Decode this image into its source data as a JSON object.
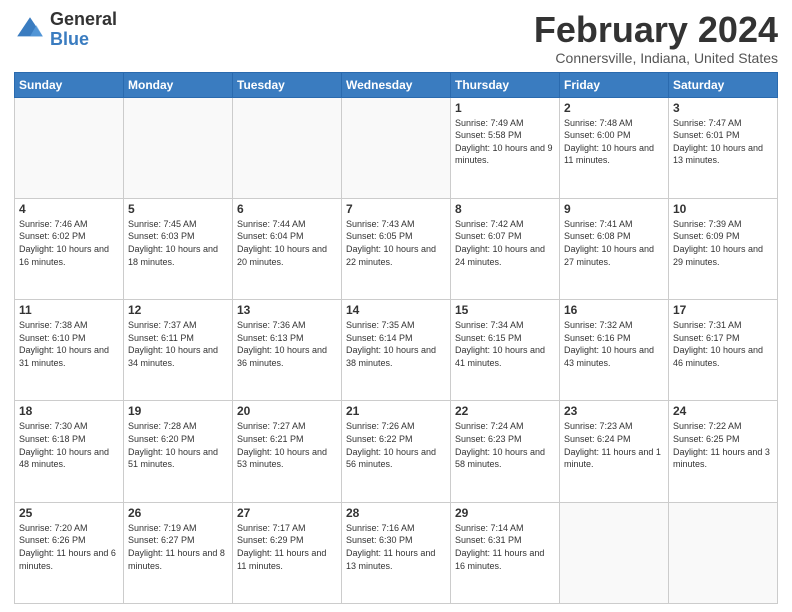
{
  "header": {
    "title": "February 2024",
    "subtitle": "Connersville, Indiana, United States",
    "logo_general": "General",
    "logo_blue": "Blue"
  },
  "days_of_week": [
    "Sunday",
    "Monday",
    "Tuesday",
    "Wednesday",
    "Thursday",
    "Friday",
    "Saturday"
  ],
  "weeks": [
    [
      {
        "day": "",
        "info": ""
      },
      {
        "day": "",
        "info": ""
      },
      {
        "day": "",
        "info": ""
      },
      {
        "day": "",
        "info": ""
      },
      {
        "day": "1",
        "info": "Sunrise: 7:49 AM\nSunset: 5:58 PM\nDaylight: 10 hours\nand 9 minutes."
      },
      {
        "day": "2",
        "info": "Sunrise: 7:48 AM\nSunset: 6:00 PM\nDaylight: 10 hours\nand 11 minutes."
      },
      {
        "day": "3",
        "info": "Sunrise: 7:47 AM\nSunset: 6:01 PM\nDaylight: 10 hours\nand 13 minutes."
      }
    ],
    [
      {
        "day": "4",
        "info": "Sunrise: 7:46 AM\nSunset: 6:02 PM\nDaylight: 10 hours\nand 16 minutes."
      },
      {
        "day": "5",
        "info": "Sunrise: 7:45 AM\nSunset: 6:03 PM\nDaylight: 10 hours\nand 18 minutes."
      },
      {
        "day": "6",
        "info": "Sunrise: 7:44 AM\nSunset: 6:04 PM\nDaylight: 10 hours\nand 20 minutes."
      },
      {
        "day": "7",
        "info": "Sunrise: 7:43 AM\nSunset: 6:05 PM\nDaylight: 10 hours\nand 22 minutes."
      },
      {
        "day": "8",
        "info": "Sunrise: 7:42 AM\nSunset: 6:07 PM\nDaylight: 10 hours\nand 24 minutes."
      },
      {
        "day": "9",
        "info": "Sunrise: 7:41 AM\nSunset: 6:08 PM\nDaylight: 10 hours\nand 27 minutes."
      },
      {
        "day": "10",
        "info": "Sunrise: 7:39 AM\nSunset: 6:09 PM\nDaylight: 10 hours\nand 29 minutes."
      }
    ],
    [
      {
        "day": "11",
        "info": "Sunrise: 7:38 AM\nSunset: 6:10 PM\nDaylight: 10 hours\nand 31 minutes."
      },
      {
        "day": "12",
        "info": "Sunrise: 7:37 AM\nSunset: 6:11 PM\nDaylight: 10 hours\nand 34 minutes."
      },
      {
        "day": "13",
        "info": "Sunrise: 7:36 AM\nSunset: 6:13 PM\nDaylight: 10 hours\nand 36 minutes."
      },
      {
        "day": "14",
        "info": "Sunrise: 7:35 AM\nSunset: 6:14 PM\nDaylight: 10 hours\nand 38 minutes."
      },
      {
        "day": "15",
        "info": "Sunrise: 7:34 AM\nSunset: 6:15 PM\nDaylight: 10 hours\nand 41 minutes."
      },
      {
        "day": "16",
        "info": "Sunrise: 7:32 AM\nSunset: 6:16 PM\nDaylight: 10 hours\nand 43 minutes."
      },
      {
        "day": "17",
        "info": "Sunrise: 7:31 AM\nSunset: 6:17 PM\nDaylight: 10 hours\nand 46 minutes."
      }
    ],
    [
      {
        "day": "18",
        "info": "Sunrise: 7:30 AM\nSunset: 6:18 PM\nDaylight: 10 hours\nand 48 minutes."
      },
      {
        "day": "19",
        "info": "Sunrise: 7:28 AM\nSunset: 6:20 PM\nDaylight: 10 hours\nand 51 minutes."
      },
      {
        "day": "20",
        "info": "Sunrise: 7:27 AM\nSunset: 6:21 PM\nDaylight: 10 hours\nand 53 minutes."
      },
      {
        "day": "21",
        "info": "Sunrise: 7:26 AM\nSunset: 6:22 PM\nDaylight: 10 hours\nand 56 minutes."
      },
      {
        "day": "22",
        "info": "Sunrise: 7:24 AM\nSunset: 6:23 PM\nDaylight: 10 hours\nand 58 minutes."
      },
      {
        "day": "23",
        "info": "Sunrise: 7:23 AM\nSunset: 6:24 PM\nDaylight: 11 hours\nand 1 minute."
      },
      {
        "day": "24",
        "info": "Sunrise: 7:22 AM\nSunset: 6:25 PM\nDaylight: 11 hours\nand 3 minutes."
      }
    ],
    [
      {
        "day": "25",
        "info": "Sunrise: 7:20 AM\nSunset: 6:26 PM\nDaylight: 11 hours\nand 6 minutes."
      },
      {
        "day": "26",
        "info": "Sunrise: 7:19 AM\nSunset: 6:27 PM\nDaylight: 11 hours\nand 8 minutes."
      },
      {
        "day": "27",
        "info": "Sunrise: 7:17 AM\nSunset: 6:29 PM\nDaylight: 11 hours\nand 11 minutes."
      },
      {
        "day": "28",
        "info": "Sunrise: 7:16 AM\nSunset: 6:30 PM\nDaylight: 11 hours\nand 13 minutes."
      },
      {
        "day": "29",
        "info": "Sunrise: 7:14 AM\nSunset: 6:31 PM\nDaylight: 11 hours\nand 16 minutes."
      },
      {
        "day": "",
        "info": ""
      },
      {
        "day": "",
        "info": ""
      }
    ]
  ]
}
